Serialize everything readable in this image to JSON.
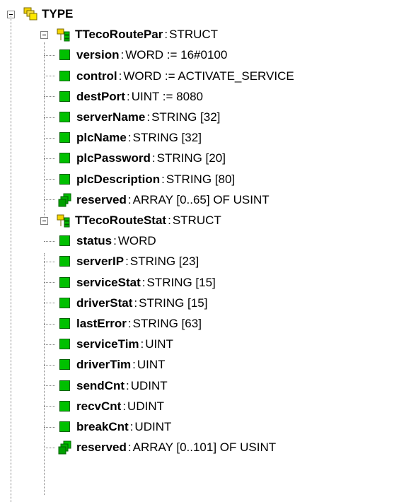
{
  "tree": {
    "root": {
      "name": "TYPE"
    },
    "groups": [
      {
        "name": "TTecoRoutePar",
        "kind": "STRUCT",
        "items": [
          {
            "name": "version",
            "type": "WORD := 16#0100",
            "icon": "member-icon"
          },
          {
            "name": "control",
            "type": "WORD := ACTIVATE_SERVICE",
            "icon": "member-icon"
          },
          {
            "name": "destPort",
            "type": "UINT := 8080",
            "icon": "member-icon"
          },
          {
            "name": "serverName",
            "type": "STRING [32]",
            "icon": "member-icon"
          },
          {
            "name": "plcName",
            "type": "STRING [32]",
            "icon": "member-icon"
          },
          {
            "name": "plcPassword",
            "type": "STRING [20]",
            "icon": "member-icon"
          },
          {
            "name": "plcDescription",
            "type": "STRING [80]",
            "icon": "member-icon"
          },
          {
            "name": "reserved",
            "type": "ARRAY [0..65] OF USINT",
            "icon": "array-icon"
          }
        ]
      },
      {
        "name": "TTecoRouteStat",
        "kind": "STRUCT",
        "items": [
          {
            "name": "status",
            "type": "WORD",
            "icon": "member-icon"
          },
          {
            "name": "serverIP",
            "type": "STRING [23]",
            "icon": "member-icon"
          },
          {
            "name": "serviceStat",
            "type": "STRING [15]",
            "icon": "member-icon"
          },
          {
            "name": "driverStat",
            "type": "STRING [15]",
            "icon": "member-icon"
          },
          {
            "name": "lastError",
            "type": "STRING [63]",
            "icon": "member-icon"
          },
          {
            "name": "serviceTim",
            "type": "UINT",
            "icon": "member-icon"
          },
          {
            "name": "driverTim",
            "type": "UINT",
            "icon": "member-icon"
          },
          {
            "name": "sendCnt",
            "type": "UDINT",
            "icon": "member-icon"
          },
          {
            "name": "recvCnt",
            "type": "UDINT",
            "icon": "member-icon"
          },
          {
            "name": "breakCnt",
            "type": "UDINT",
            "icon": "member-icon"
          },
          {
            "name": "reserved",
            "type": "ARRAY [0..101] OF USINT",
            "icon": "array-icon"
          }
        ]
      }
    ]
  },
  "colors": {
    "member": "#00c000",
    "folder": "#f0d000",
    "line": "#808080"
  }
}
